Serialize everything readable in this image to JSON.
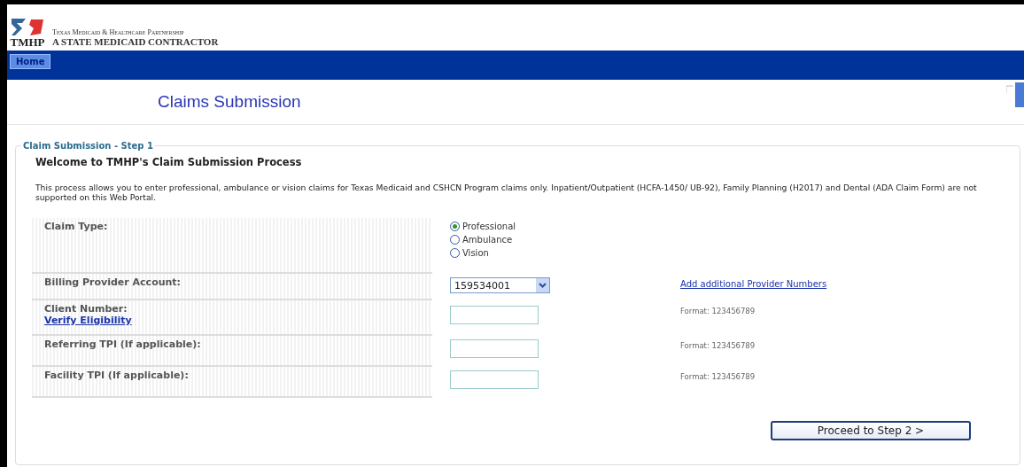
{
  "header": {
    "logo_text": "TMHP",
    "org_name": "Texas Medicaid & Healthcare Partnership",
    "tagline": "A STATE MEDICAID CONTRACTOR"
  },
  "nav": [
    {
      "label": "Home",
      "selected": true
    }
  ],
  "page_title": "Claims Submission",
  "form": {
    "legend": "Claim Submission - Step 1",
    "heading": "Welcome to TMHP's Claim Submission Process",
    "intro": "This process allows you to enter professional, ambulance or vision claims for Texas Medicaid and CSHCN Program claims only. Inpatient/Outpatient (HCFA-1450/ UB-92), Family Planning (H2017) and Dental (ADA Claim Form) are not supported on this Web Portal.",
    "rows": [
      {
        "kind": "radio",
        "label": "Claim Type:",
        "options": [
          {
            "label": "Professional",
            "selected": true
          },
          {
            "label": "Ambulance",
            "selected": false
          },
          {
            "label": "Vision",
            "selected": false
          }
        ]
      },
      {
        "kind": "select",
        "label": "Billing Provider Account:",
        "value": "159534001",
        "link": "Add additional Provider Numbers"
      },
      {
        "kind": "input",
        "label": "Client Number:",
        "sublink": "Verify Eligibility",
        "hint": "Format: 123456789"
      },
      {
        "kind": "input",
        "label": "Referring TPI (If applicable):",
        "hint": "Format: 123456789"
      },
      {
        "kind": "input",
        "label": "Facility TPI (If applicable):",
        "hint": "Format: 123456789"
      }
    ],
    "submit": "Proceed to Step 2 >"
  }
}
